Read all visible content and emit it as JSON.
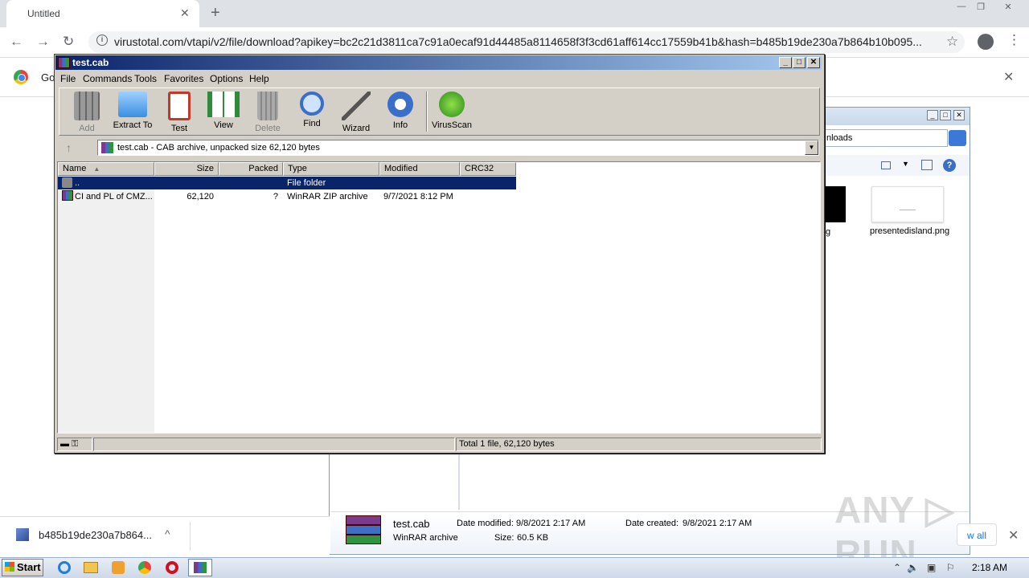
{
  "browser": {
    "tab_title": "Untitled",
    "tab_close": "✕",
    "new_tab": "+",
    "url": "virustotal.com/vtapi/v2/file/download?apikey=bc2c21d3811ca7c91a0ecaf91d44485a8114658f3f3cd61aff614cc17559b41b&hash=b485b19de230a7b864b10b095...",
    "infobar_text": "Go",
    "win_controls": [
      "—",
      "❐",
      "✕"
    ]
  },
  "winrar": {
    "title": "test.cab",
    "title_buttons": [
      "_",
      "□",
      "✕"
    ],
    "menu": [
      "File",
      "Commands",
      "Tools",
      "Favorites",
      "Options",
      "Help"
    ],
    "toolbar": [
      {
        "label": "Add",
        "icon": "add-icon",
        "disabled": true
      },
      {
        "label": "Extract To",
        "icon": "extract-folder-icon"
      },
      {
        "label": "Test",
        "icon": "test-clipboard-icon"
      },
      {
        "label": "View",
        "icon": "view-book-icon"
      },
      {
        "label": "Delete",
        "icon": "trash-icon",
        "disabled": true
      },
      {
        "label": "Find",
        "icon": "magnifier-icon"
      },
      {
        "label": "Wizard",
        "icon": "wand-icon"
      },
      {
        "label": "Info",
        "icon": "info-icon"
      },
      {
        "label": "VirusScan",
        "icon": "bug-icon"
      }
    ],
    "address": "test.cab - CAB archive, unpacked size 62,120 bytes",
    "columns": [
      "Name",
      "Size",
      "Packed",
      "Type",
      "Modified",
      "CRC32"
    ],
    "rows": [
      {
        "name": "..",
        "size": "",
        "packed": "",
        "type": "File folder",
        "modified": "",
        "crc": ""
      },
      {
        "name": "CI and PL of CMZ...",
        "size": "62,120",
        "packed": "?",
        "type": "WinRAR ZIP archive",
        "modified": "9/7/2021 8:12 PM",
        "crc": ""
      }
    ],
    "status_total": "Total 1 file, 62,120 bytes"
  },
  "explorer": {
    "address_fragment": "nloads",
    "thumb1_label": "g",
    "thumb2_label": "presentedisland.png",
    "details": {
      "name": "test.cab",
      "type": "WinRAR archive",
      "modified_label": "Date modified:",
      "modified": "9/8/2021 2:17 AM",
      "created_label": "Date created:",
      "created": "9/8/2021 2:17 AM",
      "size_label": "Size:",
      "size": "60.5 KB"
    }
  },
  "downloads": {
    "filename": "b485b19de230a7b864...",
    "show_all": "w all"
  },
  "watermark": "ANY ▷ RUN",
  "taskbar": {
    "start": "Start",
    "clock": "2:18 AM"
  }
}
